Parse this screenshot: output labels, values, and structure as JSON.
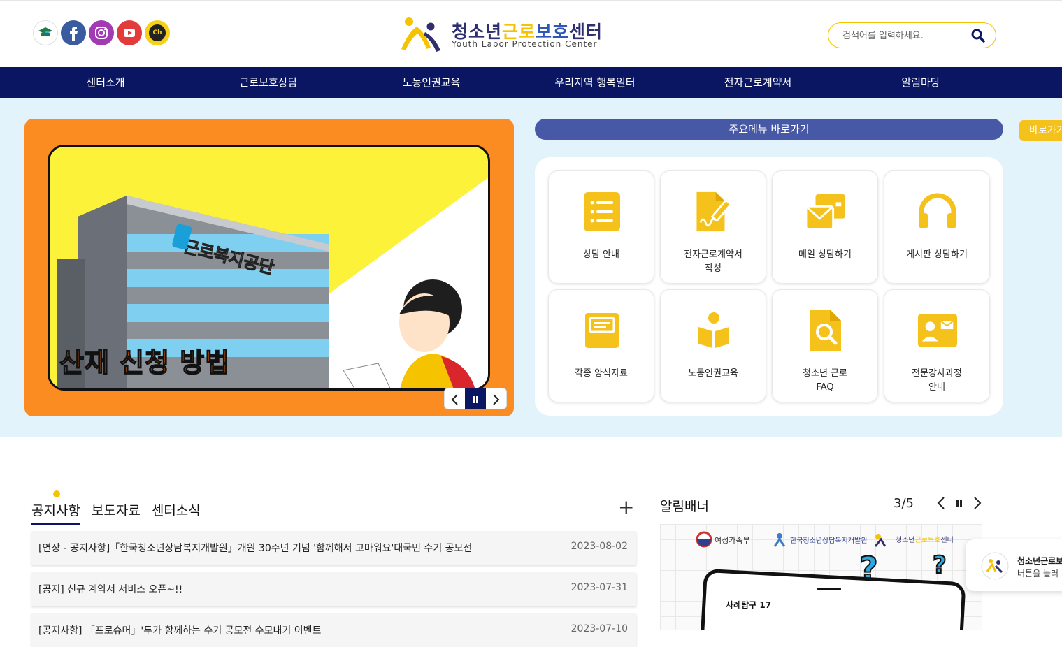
{
  "header": {
    "logo_title_prefix": "청소년",
    "logo_title_hl1": "근로",
    "logo_title_hl2": "보호",
    "logo_title_suffix": "센터",
    "logo_subtitle": "Youth Labor Protection Center",
    "search_placeholder": "검색어를 입력하세요.",
    "sns": [
      "edu-cap-icon",
      "facebook-icon",
      "instagram-icon",
      "youtube-icon",
      "kakao-channel-icon"
    ],
    "kakao_label": "Ch"
  },
  "gnb": [
    "센터소개",
    "근로보호상담",
    "노동인권교육",
    "우리지역 행복일터",
    "전자근로계약서",
    "알림마당"
  ],
  "slider": {
    "headline": "산재 신청 방법",
    "sign_text": "근로복지공단"
  },
  "quick_menu": {
    "bar_label": "주요메뉴 바로가기",
    "side_button": "바로가기",
    "tiles": [
      {
        "label": "상담 안내",
        "icon": "list-icon"
      },
      {
        "label": "전자근로계약서\n작성",
        "icon": "document-sign-icon"
      },
      {
        "label": "메일 상담하기",
        "icon": "mail-icon"
      },
      {
        "label": "게시판 상담하기",
        "icon": "headset-icon"
      },
      {
        "label": "각종 양식자료",
        "icon": "inbox-icon"
      },
      {
        "label": "노동인권교육",
        "icon": "reader-icon"
      },
      {
        "label": "청소년 근로\nFAQ",
        "icon": "file-search-icon"
      },
      {
        "label": "전문강사과정\n안내",
        "icon": "contact-card-icon"
      }
    ]
  },
  "news": {
    "tabs": [
      "공지사항",
      "보도자료",
      "센터소식"
    ],
    "more_label": "+",
    "items": [
      {
        "title": "[연장 - 공지사항]「한국청소년상담복지개발원」개원 30주년 기념 '함께해서 고마워요'대국민 수기 공모전",
        "date": "2023-08-02"
      },
      {
        "title": "[공지] 신규 계약서 서비스 오픈~!!",
        "date": "2023-07-31"
      },
      {
        "title": "[공지사항] 「프로슈머」'두가 함께하는 수기 공모전 수모내기 이벤트",
        "date": "2023-07-10"
      }
    ]
  },
  "banner": {
    "title": "알림배너",
    "counter": "3/5",
    "org1": "여성가족부",
    "org2": "한국청소년상담복지개발원",
    "org3_prefix": "청소년",
    "org3_hl": "근로보호",
    "org3_suffix": "센터",
    "tag": "사례탐구 17"
  },
  "kakao_popup": {
    "line1": "청소년근로보",
    "line2": "버튼을 눌러 "
  },
  "colors": {
    "navy": "#0a1662",
    "yellow": "#f5c21b",
    "orange": "#fb8c22",
    "hero_bg": "#e2f3fb",
    "quick_bar": "#4658a6"
  }
}
